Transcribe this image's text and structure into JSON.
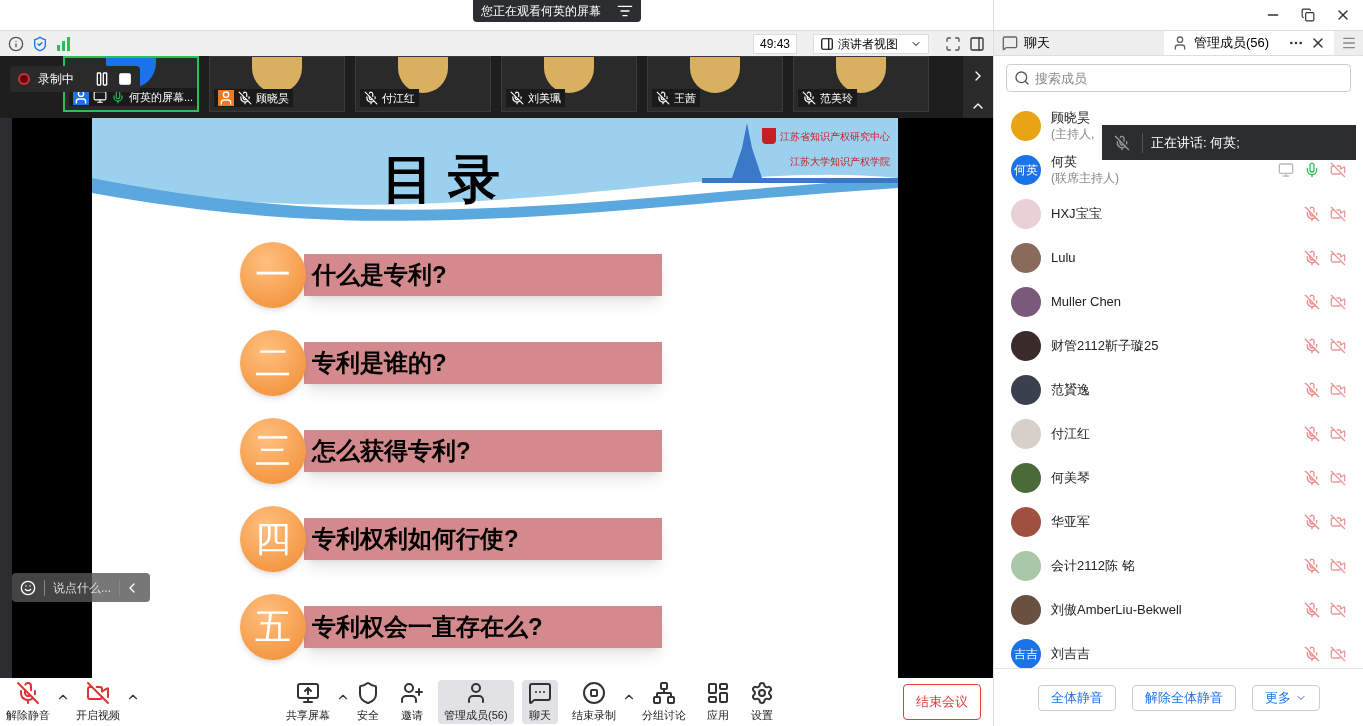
{
  "banner": {
    "text": "您正在观看何英的屏幕"
  },
  "toolbar": {
    "timer": "49:43",
    "view_mode": "演讲者视图"
  },
  "recording": {
    "label": "录制中"
  },
  "thumbnails": [
    {
      "name": "何英的屏幕...",
      "selected": true,
      "muted": false,
      "kind": "sharing"
    },
    {
      "name": "顾晓昊",
      "selected": false,
      "muted": true,
      "kind": "host"
    },
    {
      "name": "付江红",
      "selected": false,
      "muted": true,
      "kind": "guest"
    },
    {
      "name": "刘美珮",
      "selected": false,
      "muted": true,
      "kind": "guest"
    },
    {
      "name": "王茜",
      "selected": false,
      "muted": true,
      "kind": "guest"
    },
    {
      "name": "范美玲",
      "selected": false,
      "muted": true,
      "kind": "guest"
    }
  ],
  "slide": {
    "title": "目 录",
    "org_top": "江苏省知识产权研究中心",
    "org_bottom": "江苏大学知识产权学院",
    "items": [
      {
        "numeral": "一",
        "text": "什么是专利?"
      },
      {
        "numeral": "二",
        "text": "专利是谁的?"
      },
      {
        "numeral": "三",
        "text": "怎么获得专利?"
      },
      {
        "numeral": "四",
        "text": "专利权利如何行使?"
      },
      {
        "numeral": "五",
        "text": "专利权会一直存在么?"
      }
    ]
  },
  "chat_input": {
    "placeholder": "说点什么..."
  },
  "bottom_toolbar": [
    {
      "kind": "mic-off",
      "label": "解除静音",
      "caret": true,
      "active": false
    },
    {
      "kind": "video-off",
      "label": "开启视频",
      "caret": true,
      "active": false
    },
    {
      "kind": "share",
      "label": "共享屏幕",
      "caret": true,
      "active": false
    },
    {
      "kind": "security",
      "label": "安全",
      "caret": false,
      "active": false
    },
    {
      "kind": "invite",
      "label": "邀请",
      "caret": false,
      "active": false
    },
    {
      "kind": "members",
      "label": "管理成员(56)",
      "caret": false,
      "active": true
    },
    {
      "kind": "chat",
      "label": "聊天",
      "caret": false,
      "active": true
    },
    {
      "kind": "record",
      "label": "结束录制",
      "caret": true,
      "active": false
    },
    {
      "kind": "breakout",
      "label": "分组讨论",
      "caret": false,
      "active": false
    },
    {
      "kind": "apps",
      "label": "应用",
      "caret": false,
      "active": false
    },
    {
      "kind": "settings",
      "label": "设置",
      "caret": false,
      "active": false
    }
  ],
  "end_button": "结束会议",
  "panel": {
    "tabs": [
      {
        "label": "聊天",
        "selected": false
      },
      {
        "label": "管理成员(56)",
        "selected": true
      }
    ],
    "search": {
      "placeholder": "搜索成员"
    },
    "speaking": "正在讲话: 何英;",
    "members": [
      {
        "name": "顾晓昊",
        "role": "(主持人,",
        "kind": "photo",
        "color": "#e8a317"
      },
      {
        "name": "何英",
        "role": "(联席主持人)",
        "kind": "initials",
        "initials": "何英",
        "color": "#1a73e8",
        "muted": false,
        "video_off": true,
        "sharing": true
      },
      {
        "name": "HXJ宝宝",
        "kind": "photo",
        "color": "#e8d0d4",
        "muted": true,
        "video_off": true
      },
      {
        "name": "Lulu",
        "kind": "photo",
        "color": "#8a6a5a",
        "muted": true,
        "video_off": true
      },
      {
        "name": "Muller Chen",
        "kind": "photo",
        "color": "#7a5a7a",
        "muted": true,
        "video_off": true
      },
      {
        "name": "财管2112靳子璇25",
        "kind": "photo",
        "color": "#3a2a2a",
        "muted": true,
        "video_off": true
      },
      {
        "name": "范贇逸",
        "kind": "photo",
        "color": "#3a4050",
        "muted": true,
        "video_off": true
      },
      {
        "name": "付江红",
        "kind": "photo",
        "color": "#d8d0c8",
        "muted": true,
        "video_off": true
      },
      {
        "name": "何美琴",
        "kind": "photo",
        "color": "#4a6a3a",
        "muted": true,
        "video_off": true
      },
      {
        "name": "华亚军",
        "kind": "photo",
        "color": "#a05040",
        "muted": true,
        "video_off": true
      },
      {
        "name": "会计2112陈 铭",
        "kind": "photo",
        "color": "#a8c8a8",
        "muted": true,
        "video_off": true
      },
      {
        "name": "刘傲AmberLiu-Bekwell",
        "kind": "photo",
        "color": "#6a5040",
        "muted": true,
        "video_off": true
      },
      {
        "name": "刘吉吉",
        "kind": "initials",
        "initials": "吉吉",
        "color": "#1a73e8",
        "muted": true,
        "video_off": true
      }
    ],
    "actions": [
      {
        "label": "全体静音",
        "dropdown": false
      },
      {
        "label": "解除全体静音",
        "dropdown": false
      },
      {
        "label": "更多",
        "dropdown": true
      }
    ]
  }
}
